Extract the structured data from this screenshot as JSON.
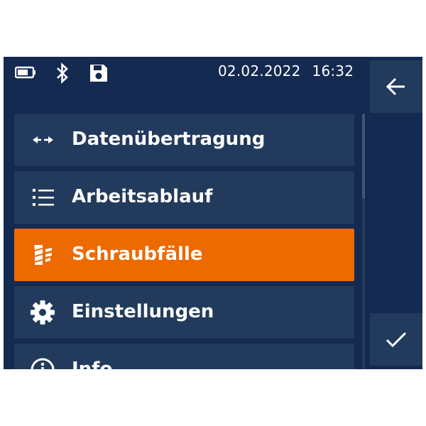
{
  "status_bar": {
    "icons": [
      "battery-icon",
      "bluetooth-icon",
      "save-icon"
    ],
    "date": "02.02.2022",
    "time": "16:32"
  },
  "menu": {
    "items": [
      {
        "label": "Datenübertragung",
        "icon": "transfer-arrows-icon",
        "active": false
      },
      {
        "label": "Arbeitsablauf",
        "icon": "list-icon",
        "active": false
      },
      {
        "label": "Schraubfälle",
        "icon": "screw-thread-icon",
        "active": true
      },
      {
        "label": "Einstellungen",
        "icon": "gear-icon",
        "active": false
      },
      {
        "label": "Info",
        "icon": "info-icon",
        "active": false
      }
    ]
  },
  "side_buttons": {
    "back_icon": "arrow-left-icon",
    "confirm_icon": "checkmark-icon"
  },
  "colors": {
    "background": "#142a51",
    "tile": "#223b5c",
    "active": "#ec6a00",
    "text": "#ffffff"
  }
}
